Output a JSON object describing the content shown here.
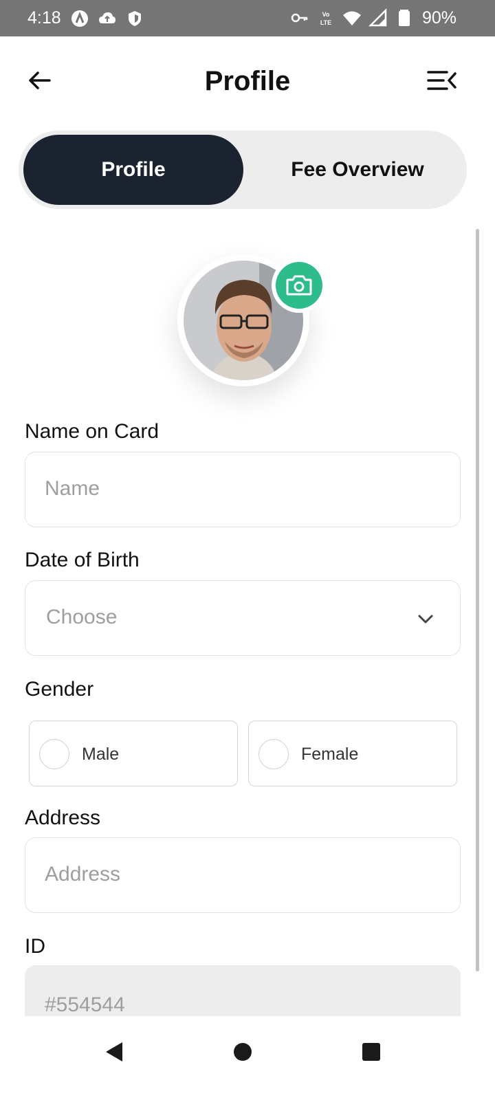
{
  "status_bar": {
    "time": "4:18",
    "battery": "90%",
    "left_icons": [
      "assistant-icon",
      "cloud-upload-icon",
      "shield-icon"
    ],
    "right_icons": [
      "vpn-key-icon",
      "volte-icon",
      "wifi-icon",
      "signal-icon",
      "battery-icon"
    ]
  },
  "header": {
    "title": "Profile",
    "back_icon": "back-arrow-icon",
    "menu_icon": "menu-collapse-icon"
  },
  "tabs": [
    {
      "label": "Profile",
      "active": true
    },
    {
      "label": "Fee Overview",
      "active": false
    }
  ],
  "avatar": {
    "camera_icon": "camera-icon"
  },
  "form": {
    "name": {
      "label": "Name on Card",
      "placeholder": "Name",
      "value": ""
    },
    "dob": {
      "label": "Date of Birth",
      "placeholder": "Choose"
    },
    "gender": {
      "label": "Gender",
      "options": [
        {
          "label": "Male",
          "selected": false
        },
        {
          "label": "Female",
          "selected": false
        }
      ]
    },
    "address": {
      "label": "Address",
      "placeholder": "Address",
      "value": ""
    },
    "id": {
      "label": "ID",
      "value": "#554544"
    }
  },
  "nav_bar": {
    "items": [
      "back-triangle-icon",
      "home-circle-icon",
      "recents-square-icon"
    ]
  },
  "colors": {
    "active_tab": "#1b2230",
    "accent": "#2ebd8a",
    "status_bar": "#757575"
  }
}
